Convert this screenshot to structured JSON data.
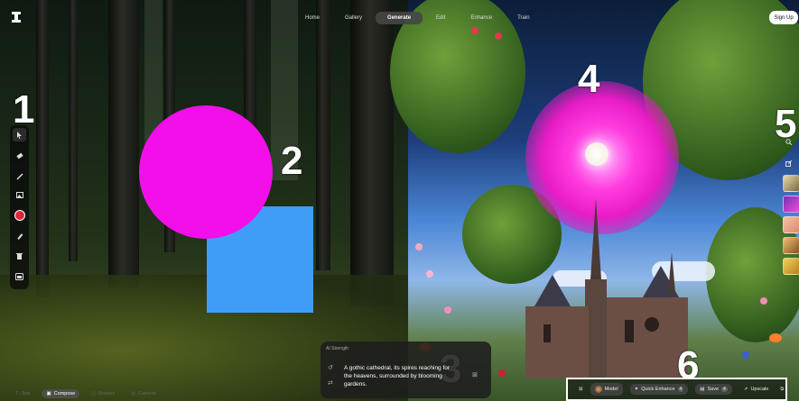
{
  "nav": {
    "tabs": [
      {
        "label": "Home"
      },
      {
        "label": "Gallery"
      },
      {
        "label": "Generate",
        "active": true
      },
      {
        "label": "Edit"
      },
      {
        "label": "Enhance"
      },
      {
        "label": "Train"
      }
    ],
    "signup_label": "Sign Up"
  },
  "markers": [
    "1",
    "2",
    "3",
    "4",
    "5",
    "6"
  ],
  "left_toolbar": {
    "tools": [
      "select-icon",
      "eraser-icon",
      "brush-icon",
      "image-icon",
      "color-picker",
      "pencil-icon",
      "trash-icon",
      "canvas-icon"
    ],
    "color": "#e0253d"
  },
  "right_toolbar": {
    "tools": [
      "search-icon",
      "export-icon"
    ],
    "thumbnail_count": 5
  },
  "modes": [
    {
      "label": "Text"
    },
    {
      "label": "Compose",
      "active": true
    },
    {
      "label": "Scenes"
    },
    {
      "label": "Camera"
    }
  ],
  "prompt": {
    "strength_label": "AI Strength",
    "text": "A gothic cathedral, its spires reaching for the heavens, surrounded by blooming gardens."
  },
  "bottom_bar": {
    "model_label": "Model",
    "quick_enhance_label": "Quick Enhance",
    "quick_enhance_count": "4",
    "save_label": "Save",
    "save_count": "4",
    "upscale_label": "Upscale"
  },
  "shapes": {
    "circle_color": "#f20fea",
    "square_color": "#3f9df5"
  }
}
